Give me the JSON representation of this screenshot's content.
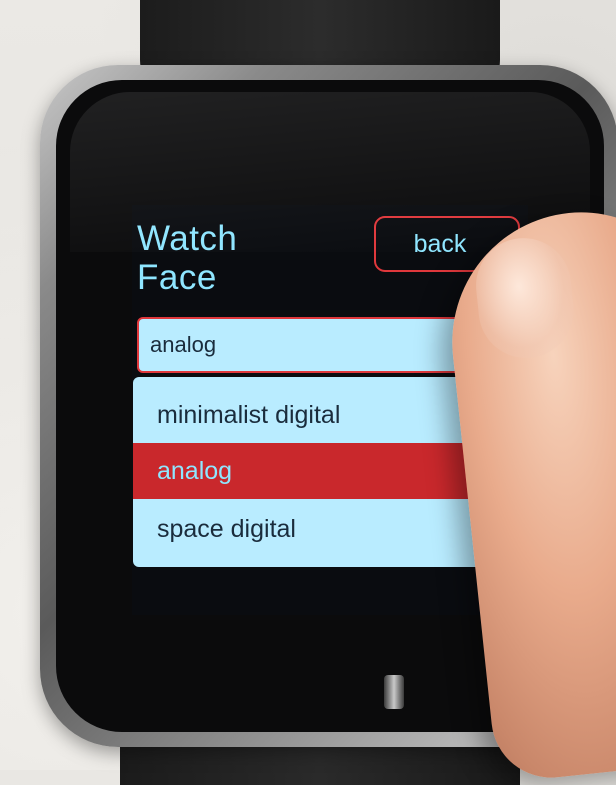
{
  "screen": {
    "title_line1": "Watch",
    "title_line2": "Face",
    "back_label": "back",
    "selected_value": "analog",
    "dropdown_options": [
      {
        "label": "minimalist digital",
        "selected": false
      },
      {
        "label": "analog",
        "selected": true
      },
      {
        "label": "space digital",
        "selected": false
      }
    ]
  },
  "colors": {
    "accent_text": "#8fe6ff",
    "border_red": "#e0383c",
    "selected_row": "#c9282c",
    "list_background": "#b9ecff",
    "screen_background": "#0a0c10"
  },
  "icons": {
    "crown": "side-button-icon"
  }
}
